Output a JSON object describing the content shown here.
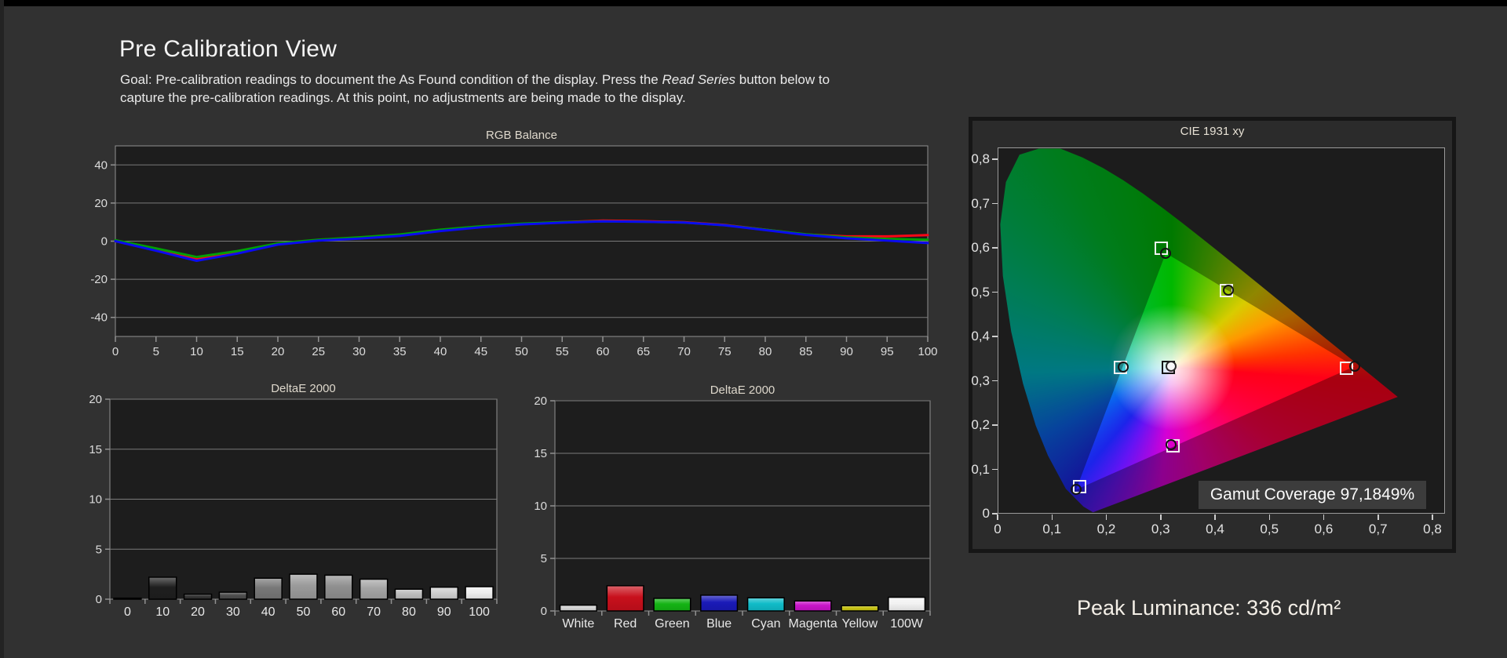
{
  "header": {
    "title": "Pre Calibration View",
    "goal_part1": "Goal: Pre-calibration readings to document the As Found condition of the display. Press the ",
    "goal_italic": "Read Series",
    "goal_part2": " button below to",
    "goal_line2": "capture the pre-calibration readings. At this point, no adjustments are being made to the display."
  },
  "peak_luminance": "Peak Luminance: 336 cd/m²",
  "colors": {
    "page_bg": "#313131",
    "plot_bg": "#1d1d1d",
    "plot_border": "#919191",
    "gridline": "#7a7a7a",
    "tick_text": "#dcdcdc",
    "chart_title_text": "#ded8cc",
    "red_line": "#fb0617",
    "green_line": "#009f05",
    "blue_line": "#0b0bf0"
  },
  "chart_data": [
    {
      "id": "rgb_balance",
      "type": "line",
      "title": "RGB Balance",
      "x": [
        0,
        5,
        10,
        15,
        20,
        25,
        30,
        35,
        40,
        45,
        50,
        55,
        60,
        65,
        70,
        75,
        80,
        85,
        90,
        95,
        100
      ],
      "x_tick_labels": [
        "0",
        "5",
        "10",
        "15",
        "20",
        "25",
        "30",
        "35",
        "40",
        "45",
        "50",
        "55",
        "60",
        "65",
        "70",
        "75",
        "80",
        "85",
        "90",
        "95",
        "100"
      ],
      "ylim": [
        -50,
        50
      ],
      "y_gridlines": [
        40,
        20,
        0,
        -20,
        -40
      ],
      "y_tick_labels": [
        "40",
        "20",
        "0",
        "-20",
        "-40"
      ],
      "grid": true,
      "legend": "none",
      "series": [
        {
          "name": "Red",
          "color": "#fb0617",
          "values": [
            0,
            -4.5,
            -9.5,
            -6.0,
            -1.5,
            0.5,
            1.5,
            3.0,
            5.5,
            7.5,
            9.0,
            10.0,
            10.8,
            10.5,
            10.0,
            8.5,
            6.0,
            3.5,
            2.5,
            2.5,
            3.2
          ]
        },
        {
          "name": "Green",
          "color": "#009f05",
          "values": [
            0.5,
            -3.8,
            -8.3,
            -5.2,
            -1.2,
            0.8,
            2.0,
            3.5,
            6.0,
            7.8,
            9.2,
            10.0,
            10.4,
            10.2,
            9.8,
            8.4,
            6.0,
            3.6,
            2.0,
            1.2,
            0.8
          ]
        },
        {
          "name": "Blue",
          "color": "#0b0bf0",
          "values": [
            0,
            -5.0,
            -10.3,
            -6.5,
            -1.8,
            0.3,
            1.3,
            2.8,
            5.3,
            7.3,
            8.8,
            9.7,
            10.4,
            10.2,
            9.8,
            8.3,
            5.8,
            3.3,
            1.5,
            0.3,
            -1.0
          ]
        }
      ]
    },
    {
      "id": "deltae_grayscale",
      "type": "bar",
      "title": "DeltaE 2000",
      "categories": [
        "0",
        "10",
        "20",
        "30",
        "40",
        "50",
        "60",
        "70",
        "80",
        "90",
        "100"
      ],
      "values": [
        0.1,
        2.2,
        0.5,
        0.7,
        2.1,
        2.5,
        2.4,
        2.0,
        1.0,
        1.2,
        1.25
      ],
      "bar_colors": [
        "#000000",
        "#1f1f1f",
        "#333333",
        "#4d4d4d",
        "#787878",
        "#9b9b9b",
        "#909090",
        "#a5a5a5",
        "#bdbdbd",
        "#cfcfcf",
        "#eeeeee"
      ],
      "ylim": [
        0,
        20
      ],
      "y_gridlines": [
        5,
        10,
        15,
        20
      ],
      "y_ticks": [
        0,
        5,
        10,
        15,
        20
      ],
      "y_tick_labels": [
        "0",
        "5",
        "10",
        "15",
        "20"
      ],
      "grid": true
    },
    {
      "id": "deltae_colors",
      "type": "bar",
      "title": "DeltaE 2000",
      "categories": [
        "White",
        "Red",
        "Green",
        "Blue",
        "Cyan",
        "Magenta",
        "Yellow",
        "100W"
      ],
      "values": [
        0.55,
        2.4,
        1.2,
        1.5,
        1.25,
        0.95,
        0.5,
        1.3
      ],
      "bar_colors": [
        "#d4d4d4",
        "#c8101c",
        "#14b414",
        "#1a1ab8",
        "#10bcc8",
        "#c814c8",
        "#c6c214",
        "#f2f2f2"
      ],
      "ylim": [
        0,
        20
      ],
      "y_gridlines": [
        5,
        10,
        15,
        20
      ],
      "y_ticks": [
        0,
        5,
        10,
        15,
        20
      ],
      "y_tick_labels": [
        "0",
        "5",
        "10",
        "15",
        "20"
      ],
      "grid": true
    },
    {
      "id": "cie_1931",
      "type": "scatter",
      "title": "CIE 1931 xy",
      "xlim": [
        0,
        0.8
      ],
      "ylim": [
        0,
        0.826
      ],
      "x_ticks": [
        0,
        0.1,
        0.2,
        0.3,
        0.4,
        0.5,
        0.6,
        0.7,
        0.8
      ],
      "x_tick_labels": [
        "0",
        "0,1",
        "0,2",
        "0,3",
        "0,4",
        "0,5",
        "0,6",
        "0,7",
        "0,8"
      ],
      "y_ticks": [
        0,
        0.1,
        0.2,
        0.3,
        0.4,
        0.5,
        0.6,
        0.7,
        0.8
      ],
      "y_tick_labels": [
        "0",
        "0,1",
        "0,2",
        "0,3",
        "0,4",
        "0,5",
        "0,6",
        "0,7",
        "0,8"
      ],
      "gamut_coverage_label": "Gamut Coverage 97,1849%",
      "gamut_triangle": [
        [
          0.655,
          0.334
        ],
        [
          0.308,
          0.59
        ],
        [
          0.143,
          0.056
        ]
      ],
      "markers": [
        {
          "name": "Green",
          "target": [
            0.3,
            0.601
          ],
          "measured": [
            0.308,
            0.59
          ]
        },
        {
          "name": "Yellow",
          "target": [
            0.419,
            0.505
          ],
          "measured": [
            0.423,
            0.506
          ]
        },
        {
          "name": "Cyan",
          "target": [
            0.225,
            0.331
          ],
          "measured": [
            0.229,
            0.332
          ]
        },
        {
          "name": "White",
          "target": [
            0.313,
            0.331
          ],
          "measured": [
            0.318,
            0.334
          ],
          "style": "dark"
        },
        {
          "name": "Red",
          "target": [
            0.64,
            0.33
          ],
          "measured": [
            0.655,
            0.334
          ]
        },
        {
          "name": "Magenta",
          "target": [
            0.321,
            0.155
          ],
          "measured": [
            0.318,
            0.157
          ]
        },
        {
          "name": "Blue",
          "target": [
            0.15,
            0.062
          ],
          "measured": [
            0.143,
            0.056
          ]
        }
      ],
      "spectral_locus": [
        [
          0.1741,
          0.005
        ],
        [
          0.1566,
          0.0177
        ],
        [
          0.1241,
          0.0578
        ],
        [
          0.0913,
          0.1327
        ],
        [
          0.0687,
          0.2007
        ],
        [
          0.0454,
          0.295
        ],
        [
          0.0235,
          0.4127
        ],
        [
          0.0082,
          0.5384
        ],
        [
          0.0034,
          0.6548
        ],
        [
          0.0139,
          0.7502
        ],
        [
          0.0389,
          0.812
        ],
        [
          0.0743,
          0.8338
        ],
        [
          0.1142,
          0.8262
        ],
        [
          0.1547,
          0.8059
        ],
        [
          0.1929,
          0.7816
        ],
        [
          0.2296,
          0.7543
        ],
        [
          0.2658,
          0.7243
        ],
        [
          0.3016,
          0.6923
        ],
        [
          0.3373,
          0.6588
        ],
        [
          0.3731,
          0.6245
        ],
        [
          0.4087,
          0.5896
        ],
        [
          0.4441,
          0.5547
        ],
        [
          0.4788,
          0.5202
        ],
        [
          0.5125,
          0.4866
        ],
        [
          0.5448,
          0.4544
        ],
        [
          0.5752,
          0.4242
        ],
        [
          0.6029,
          0.3965
        ],
        [
          0.627,
          0.3725
        ],
        [
          0.6482,
          0.3514
        ],
        [
          0.6658,
          0.334
        ],
        [
          0.6801,
          0.3197
        ],
        [
          0.6915,
          0.3083
        ],
        [
          0.7079,
          0.292
        ],
        [
          0.719,
          0.2809
        ],
        [
          0.726,
          0.274
        ],
        [
          0.7347,
          0.2653
        ]
      ]
    }
  ]
}
